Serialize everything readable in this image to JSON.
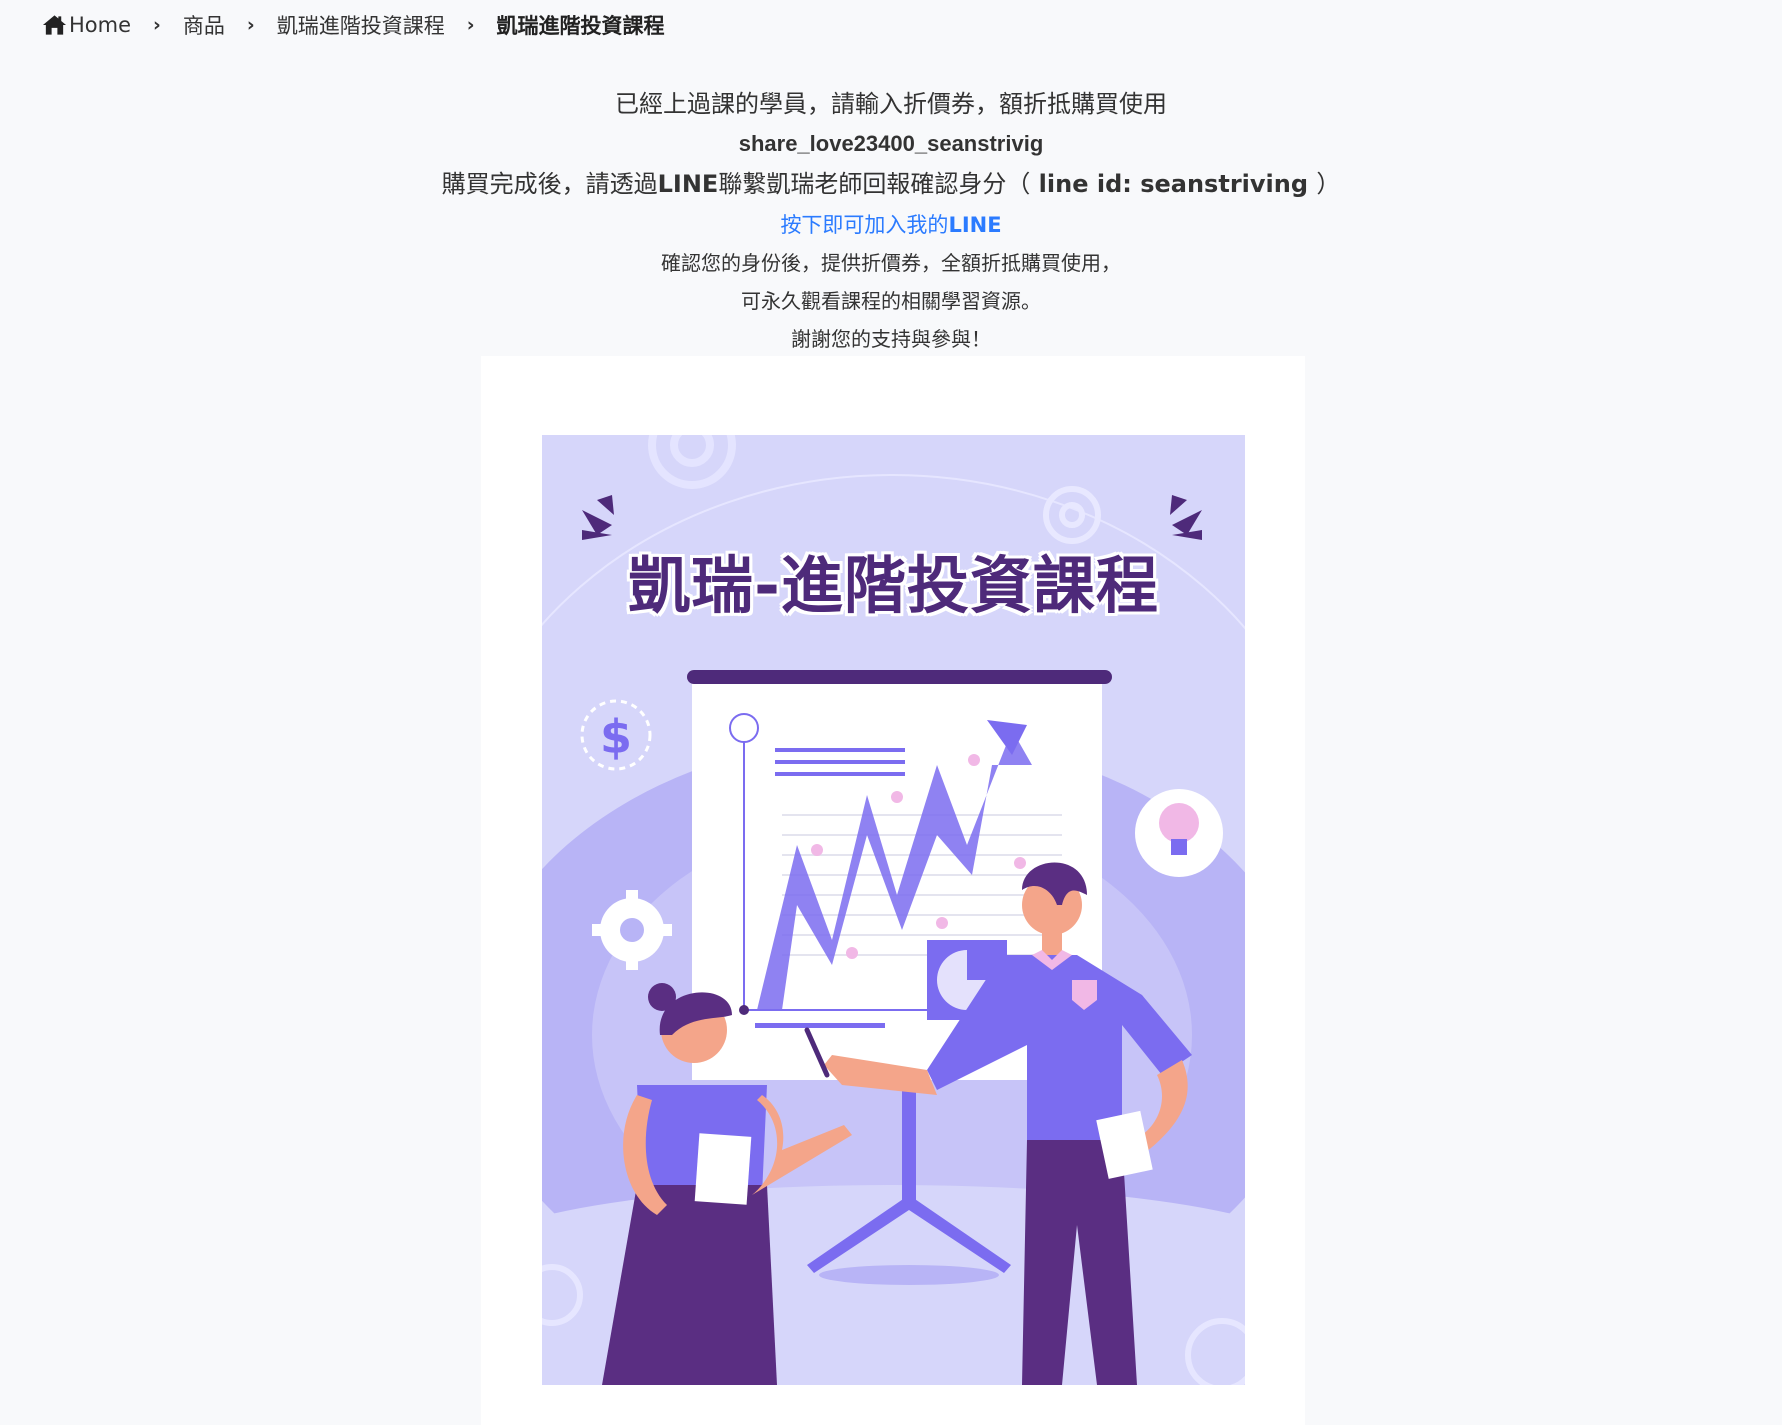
{
  "breadcrumb": {
    "home": "Home",
    "items": [
      "商品",
      "凱瑞進階投資課程"
    ],
    "current": "凱瑞進階投資課程",
    "separator": "›"
  },
  "notice": {
    "line1": "已經上過課的學員，請輸入折價券，額折抵購買使用",
    "coupon_code": "share_love23400_seanstrivig",
    "line3_prefix": "購買完成後，請透過",
    "line3_line": "LINE",
    "line3_middle": "聯繫凱瑞老師回報確認身分（",
    "line3_id": " line id: seanstriving ",
    "line3_suffix": "）",
    "link_prefix": "按下即可加入我的",
    "link_strong": "LINE",
    "line5": "確認您的身份後，提供折價券，全額折抵購買使用，",
    "line6": "可永久觀看課程的相關學習資源。",
    "line7": "謝謝您的支持與參與！"
  },
  "product_image": {
    "title": "凱瑞-進階投資課程",
    "colors": {
      "background": "#d6d6fa",
      "primary": "#7b6cf0",
      "dark": "#4e2a7a",
      "accent_pink": "#f1b8e6"
    }
  }
}
